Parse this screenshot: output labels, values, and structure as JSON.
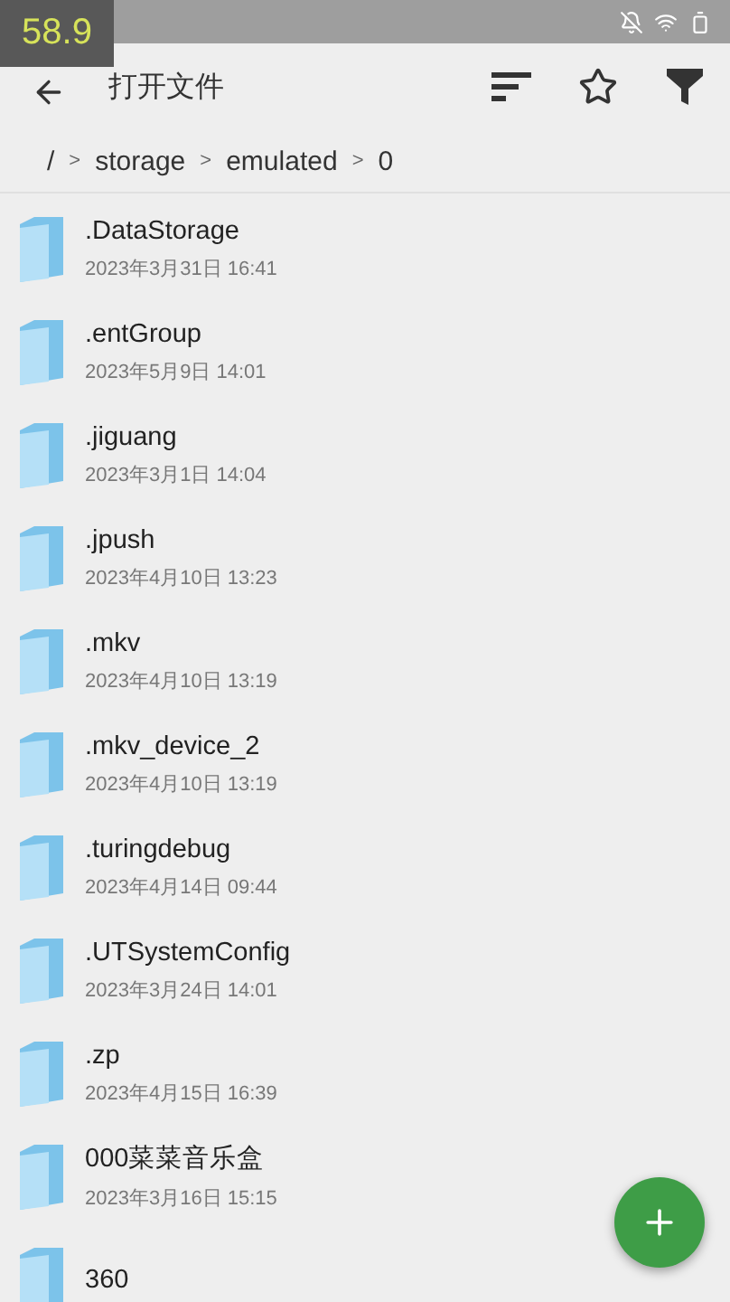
{
  "fps_overlay": "58.9",
  "toolbar": {
    "title": "打开文件"
  },
  "breadcrumb": [
    "/",
    ">",
    "storage",
    ">",
    "emulated",
    ">",
    "0"
  ],
  "files": [
    {
      "name": ".DataStorage",
      "date": "2023年3月31日 16:41"
    },
    {
      "name": ".entGroup",
      "date": "2023年5月9日 14:01"
    },
    {
      "name": ".jiguang",
      "date": "2023年3月1日 14:04"
    },
    {
      "name": ".jpush",
      "date": "2023年4月10日 13:23"
    },
    {
      "name": ".mkv",
      "date": "2023年4月10日 13:19"
    },
    {
      "name": ".mkv_device_2",
      "date": "2023年4月10日 13:19"
    },
    {
      "name": ".turingdebug",
      "date": "2023年4月14日 09:44"
    },
    {
      "name": ".UTSystemConfig",
      "date": "2023年3月24日 14:01"
    },
    {
      "name": ".zp",
      "date": "2023年4月15日 16:39"
    },
    {
      "name": "000菜菜音乐盒",
      "date": "2023年3月16日 15:15"
    },
    {
      "name": "360"
    }
  ]
}
